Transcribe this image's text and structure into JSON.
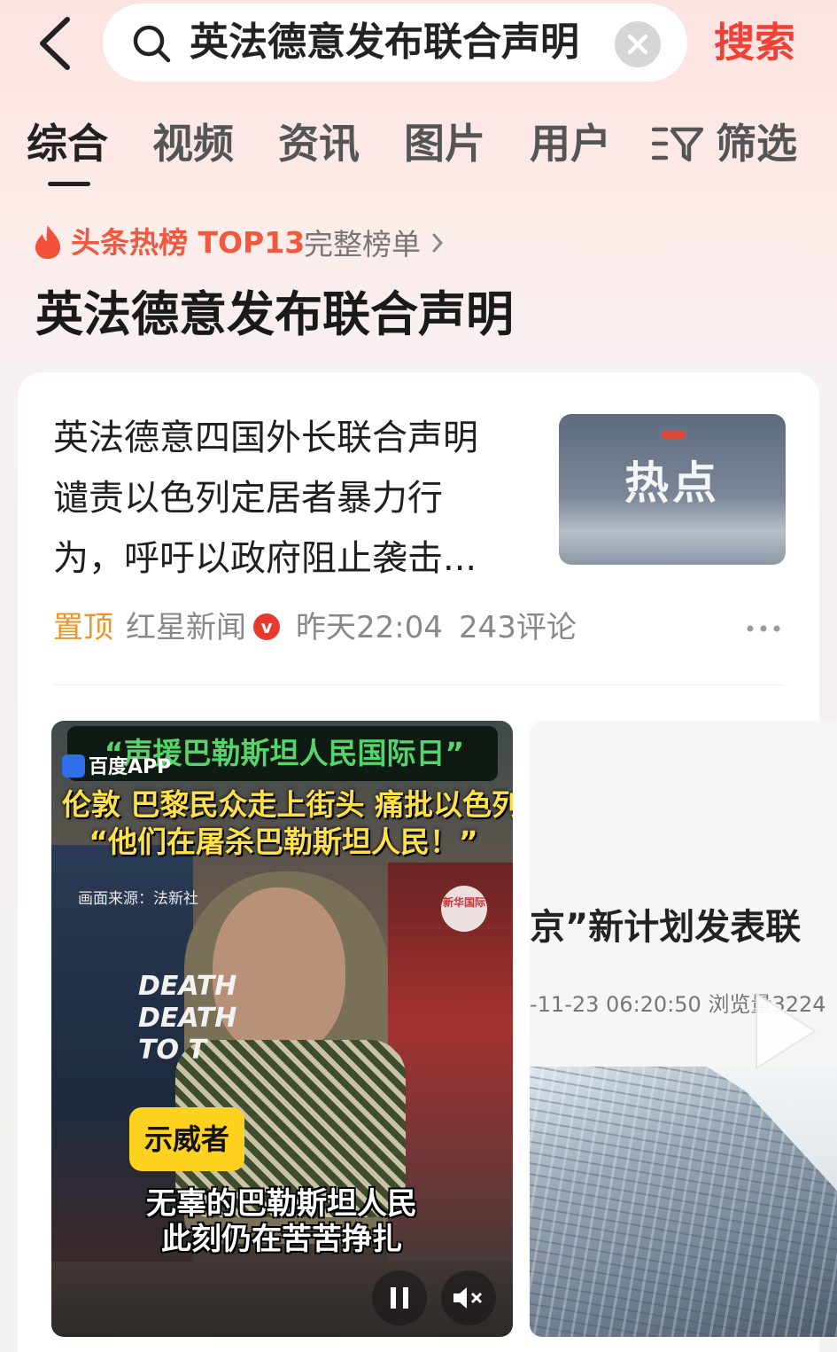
{
  "header": {
    "back_icon": "chevron-left-icon",
    "search_query": "英法德意发布联合声明",
    "search_icon": "search-icon",
    "clear_icon": "close-icon",
    "search_button": "搜索"
  },
  "tabs": [
    {
      "label": "综合",
      "active": true
    },
    {
      "label": "视频",
      "active": false
    },
    {
      "label": "资讯",
      "active": false
    },
    {
      "label": "图片",
      "active": false
    },
    {
      "label": "用户",
      "active": false
    }
  ],
  "filter": {
    "label": "筛选",
    "icon": "filter-icon"
  },
  "hot_list": {
    "icon": "flame-icon",
    "label": "头条热榜 TOP13",
    "full_list": "完整榜单",
    "topic": "英法德意发布联合声明"
  },
  "article": {
    "title_lines": [
      "英法德意四国外长联合声明",
      "谴责以色列定居者暴力行",
      "为，呼吁以政府阻止袭击..."
    ],
    "thumbnail_text": "热点",
    "pinned": "置顶",
    "source": "红星新闻",
    "verified_badge": "v",
    "time": "昨天22:04",
    "comments": "243评论",
    "more_icon": "more-icon"
  },
  "video1": {
    "banner_line1": "“声援巴勒斯坦人民国际日”",
    "app_label": "百度APP",
    "line2": "伦敦 巴黎民众走上街头 痛批以色列",
    "line3": "“他们在屠杀巴勒斯坦人民！”",
    "footage_source": "画面来源：法新社",
    "logo_text": "新华国际",
    "sign_text": "DEATH DEATH TO T",
    "tag": "示威者",
    "subtitle_line1": "无辜的巴勒斯坦人民",
    "subtitle_line2": "此刻仍在苦苦挣扎",
    "pause_icon": "pause-icon",
    "mute_icon": "mute-icon"
  },
  "video2": {
    "headline": "京”新计划发表联",
    "date": "-11-23 06:20:50  浏览量3224",
    "play_icon": "play-icon"
  }
}
